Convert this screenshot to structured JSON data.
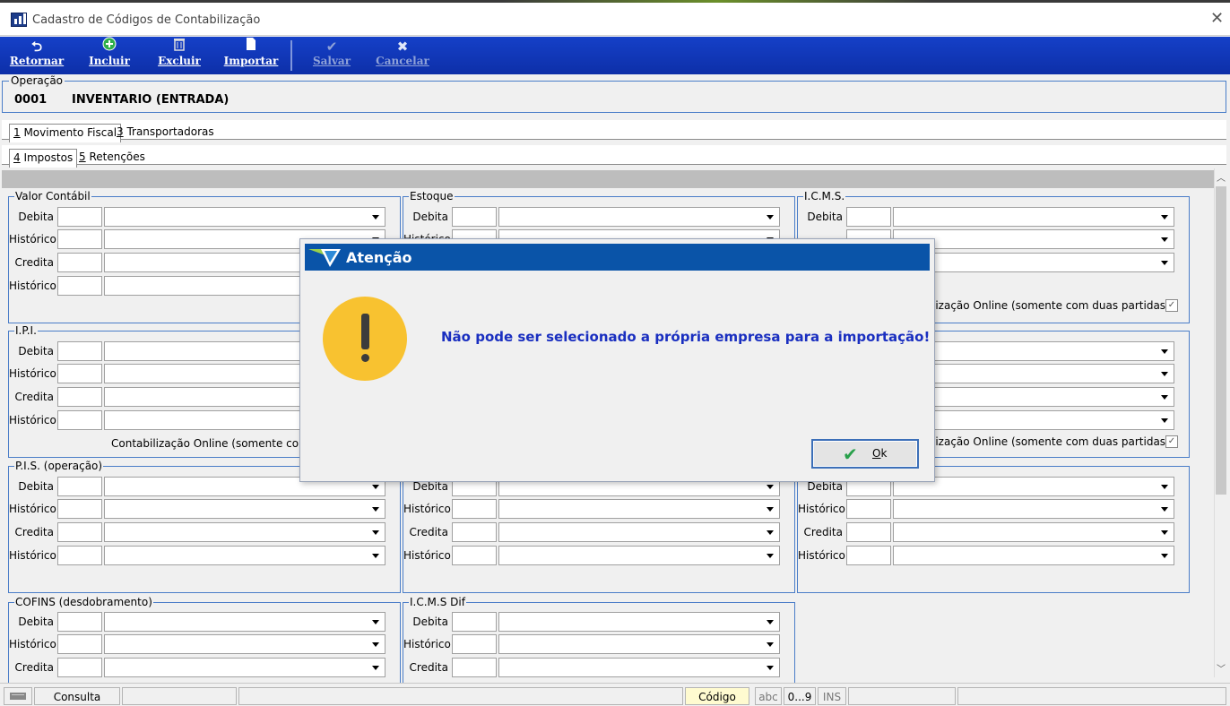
{
  "window": {
    "title": "Cadastro de Códigos de Contabilização",
    "close": "✕"
  },
  "toolbar": {
    "retornar": "Retornar",
    "incluir": "Incluir",
    "excluir": "Excluir",
    "importar": "Importar",
    "salvar": "Salvar",
    "cancelar": "Cancelar",
    "icons": {
      "retornar": "arrow-back-icon",
      "incluir": "plus-circle-icon",
      "excluir": "trash-icon",
      "importar": "document-icon",
      "salvar": "check-icon",
      "cancelar": "x-icon"
    }
  },
  "operacao": {
    "legend": "Operação",
    "code": "0001",
    "name": "INVENTARIO (ENTRADA)"
  },
  "tabs1": [
    {
      "num": "1",
      "label": " Movimento Fiscal"
    },
    {
      "num": "3",
      "label": " Transportadoras"
    }
  ],
  "tabs2": [
    {
      "num": "4",
      "label": " Impostos"
    },
    {
      "num": "5",
      "label": " Retenções"
    }
  ],
  "labels": {
    "debita": "Debita",
    "historico": "Histórico",
    "credita": "Credita"
  },
  "groups": {
    "valor_contabil": "Valor Contábil",
    "estoque": "Estoque",
    "icms": "I.C.M.S.",
    "ipi": "I.P.I.",
    "pis": "P.I.S. (operação)",
    "cofins": "COFINS (desdobramento)",
    "icms_dif": "I.C.M.S Dif"
  },
  "online": {
    "icms": "lização Online (somente com duas partidas)",
    "ipi": "Contabilização Online (somente com d",
    "right2": "lização Online (somente com duas partidas)",
    "checked": "✓"
  },
  "dialog": {
    "title": "Atenção",
    "message": "Não pode ser selecionado a própria empresa para a importação!",
    "ok_mnemonic": "O",
    "ok_rest": "k",
    "ok_check": "✔",
    "icon": "warning-icon"
  },
  "status": {
    "consulta": "Consulta",
    "codigo": "Código",
    "abc": "abc",
    "num": "0...9",
    "ins": "INS"
  },
  "colors": {
    "toolbar": "#1540c8",
    "dialog_title": "#0a54a8",
    "message": "#1a2fc0",
    "warning": "#f8c230"
  }
}
